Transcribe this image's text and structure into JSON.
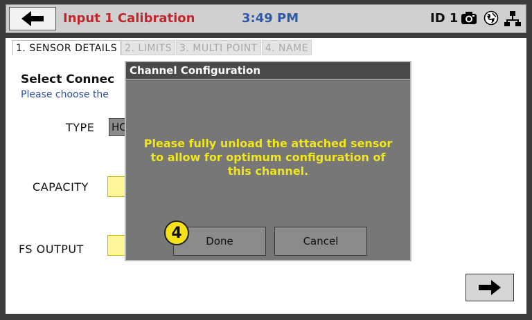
{
  "header": {
    "title": "Input 1 Calibration",
    "time": "3:49 PM",
    "id_label": "ID 1",
    "icons": [
      "back-arrow-icon",
      "camera-icon",
      "globe-icon",
      "network-icon"
    ],
    "colors": {
      "title": "#c0272d",
      "time": "#2e5aa8"
    }
  },
  "tabs": [
    {
      "label": "1. SENSOR DETAILS",
      "active": true
    },
    {
      "label": "2. LIMITS",
      "active": false
    },
    {
      "label": "3. MULTI POINT",
      "active": false
    },
    {
      "label": "4. NAME",
      "active": false
    }
  ],
  "main": {
    "section_title": "Select Connec",
    "section_subtitle": "Please choose the",
    "type_label": "TYPE",
    "type_value": "HC",
    "capacity_label": "CAPACITY",
    "fs_output_label": "FS OUTPUT",
    "next_icon": "right-arrow-icon"
  },
  "dialog": {
    "title": "Channel Configuration",
    "message": "Please fully unload the attached sensor to allow for optimum configuration of this channel.",
    "done_label": "Done",
    "cancel_label": "Cancel",
    "colors": {
      "message": "#f0e61e"
    }
  },
  "callout": {
    "number": "4"
  }
}
